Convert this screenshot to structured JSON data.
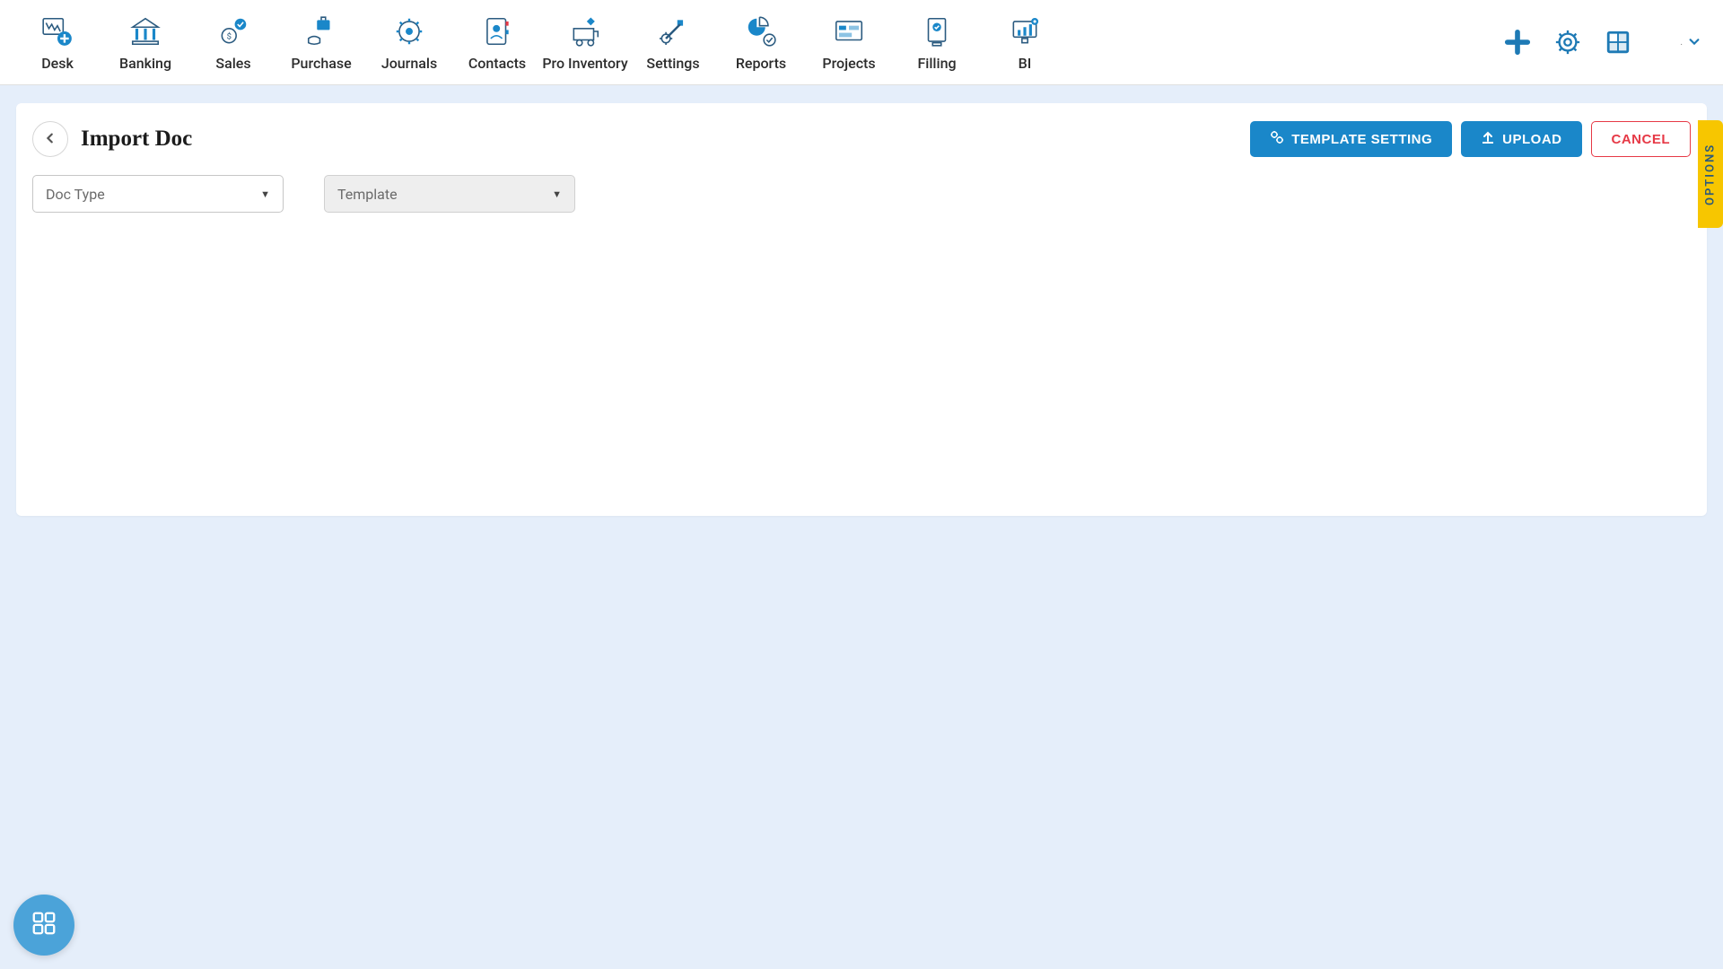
{
  "nav": {
    "items": [
      {
        "label": "Desk"
      },
      {
        "label": "Banking"
      },
      {
        "label": "Sales"
      },
      {
        "label": "Purchase"
      },
      {
        "label": "Journals"
      },
      {
        "label": "Contacts"
      },
      {
        "label": "Pro Inventory"
      },
      {
        "label": "Settings"
      },
      {
        "label": "Reports"
      },
      {
        "label": "Projects"
      },
      {
        "label": "Filling"
      },
      {
        "label": "BI"
      }
    ],
    "user_label": "."
  },
  "page": {
    "title": "Import Doc",
    "actions": {
      "template_setting": "TEMPLATE SETTING",
      "upload": "UPLOAD",
      "cancel": "CANCEL"
    },
    "selects": {
      "doc_type": "Doc Type",
      "template": "Template"
    }
  },
  "side_tab": "OPTIONS"
}
